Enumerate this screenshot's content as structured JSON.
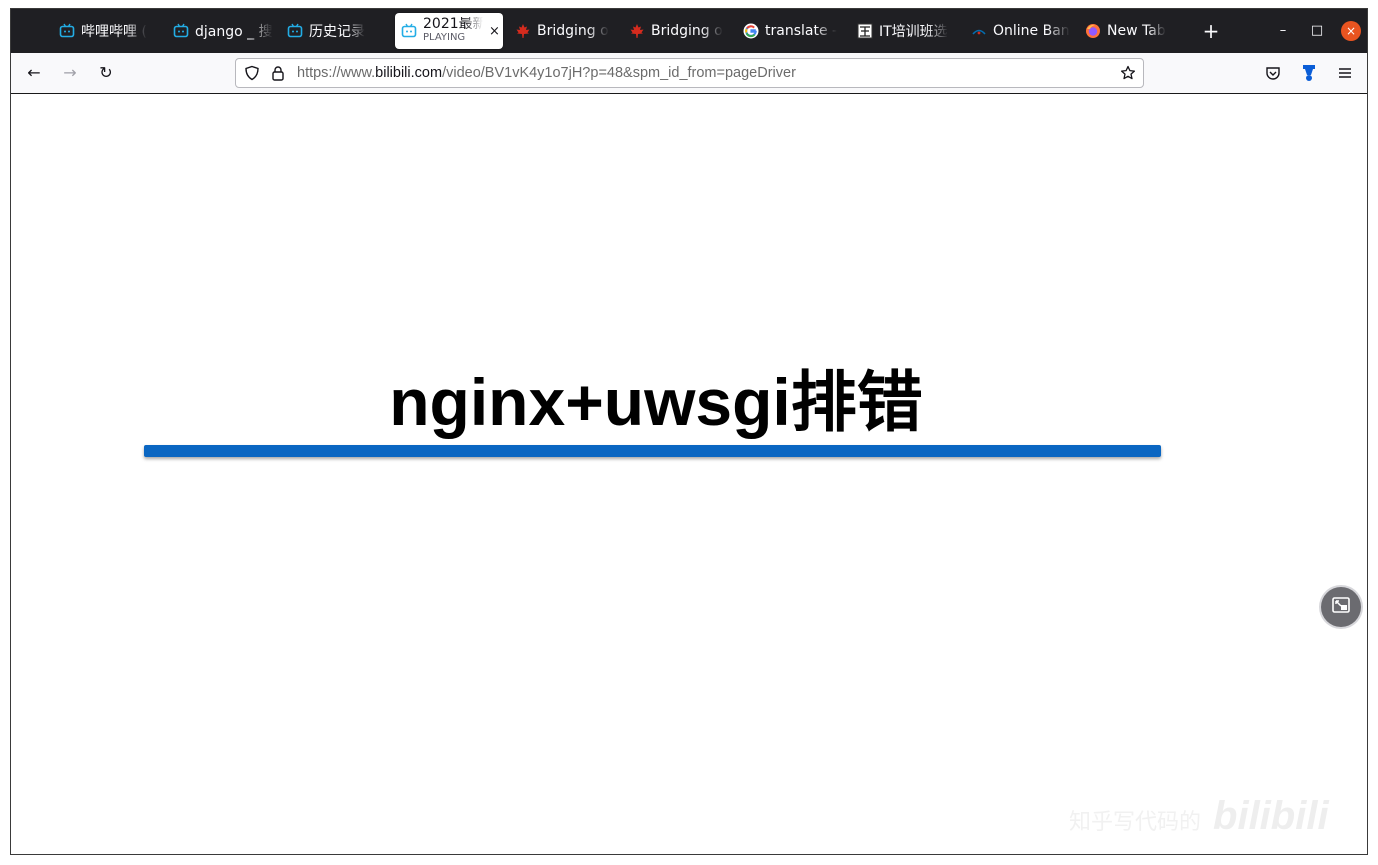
{
  "browser": {
    "tabs": [
      {
        "label": "哔哩哔哩 (",
        "icon": "bilibili-icon"
      },
      {
        "label": "django _ 搜",
        "icon": "bilibili-icon"
      },
      {
        "label": "历史记录",
        "icon": "bilibili-icon"
      },
      {
        "label": "2021最新",
        "sublabel": "PLAYING",
        "icon": "bilibili-icon",
        "active": true,
        "close": "×"
      },
      {
        "label": "Bridging o",
        "icon": "maple-leaf-icon"
      },
      {
        "label": "Bridging o",
        "icon": "maple-leaf-icon"
      },
      {
        "label": "translate -",
        "icon": "google-icon"
      },
      {
        "label": "IT培训班选",
        "icon": "site-icon"
      },
      {
        "label": "Online Ban",
        "icon": "bank-icon"
      },
      {
        "label": "New Tab",
        "icon": "firefox-icon"
      }
    ],
    "new_tab": "+",
    "window_controls": {
      "minimize": "–",
      "maximize": "□",
      "close": "×"
    },
    "nav": {
      "back": "←",
      "forward": "→",
      "reload": "↻"
    },
    "url": {
      "prefix": "https://www.",
      "host": "bilibili.com",
      "path": "/video/BV1vK4y1o7jH?p=48&spm_id_from=pageDriver"
    },
    "toolbar_icons": [
      "pocket-icon",
      "extension-icon",
      "menu-icon"
    ],
    "accent_color": "#0a66c2"
  },
  "video": {
    "slide_title": "nginx+uwsgi排错",
    "watermark_text": "知乎写代码的",
    "watermark_logo": "bilibili"
  }
}
